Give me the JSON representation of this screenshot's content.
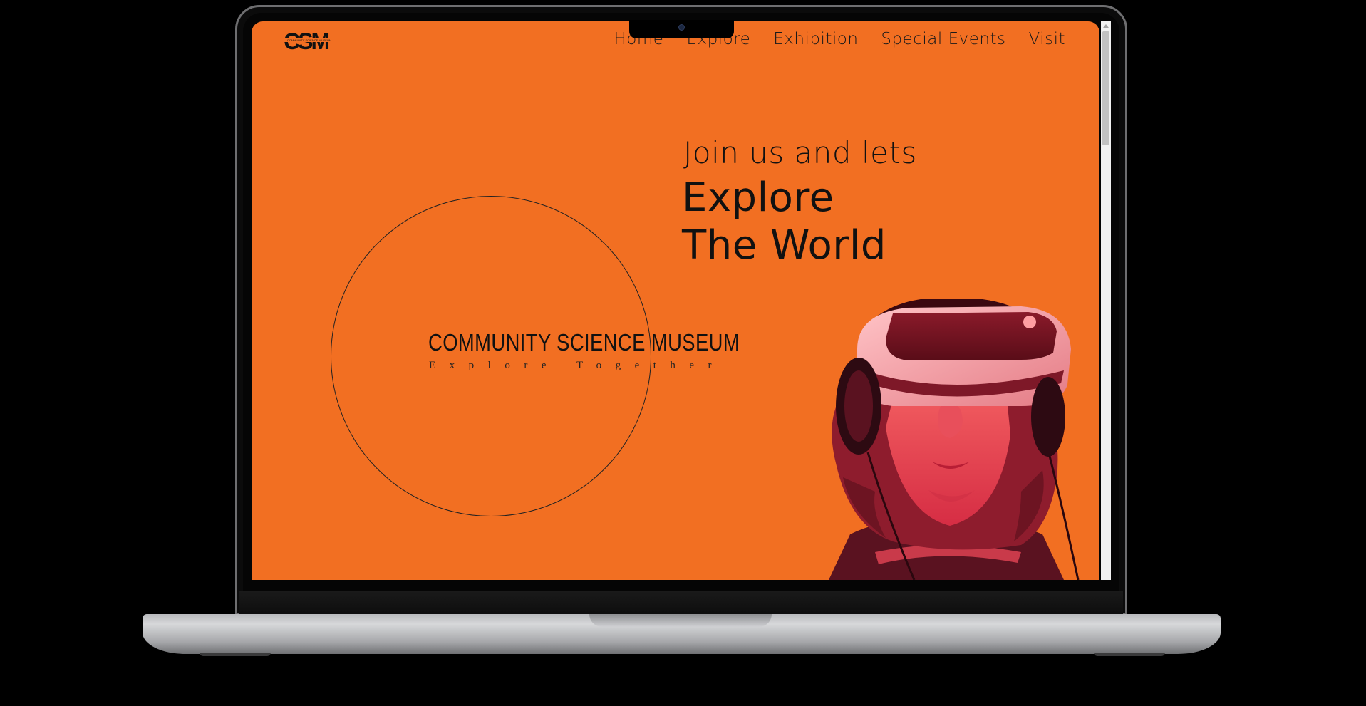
{
  "site": {
    "logo_text": "CSM",
    "logo_subtext": "COMMUNITY SCIENCE MUSEUM"
  },
  "nav": {
    "items": [
      "Home",
      "Explore",
      "Exhibition",
      "Special Events",
      "Visit"
    ]
  },
  "hero": {
    "line1": "Join us and lets",
    "line2": "Explore",
    "line3": "The World"
  },
  "emblem": {
    "title": "COMMUNITY SCIENCE MUSEUM",
    "tagline": "Explore Together"
  },
  "colors": {
    "background": "#f26f22",
    "text": "#111111",
    "image_tint": "#e8384a"
  },
  "icons": {
    "hero_image": "person-with-vr-headset"
  }
}
